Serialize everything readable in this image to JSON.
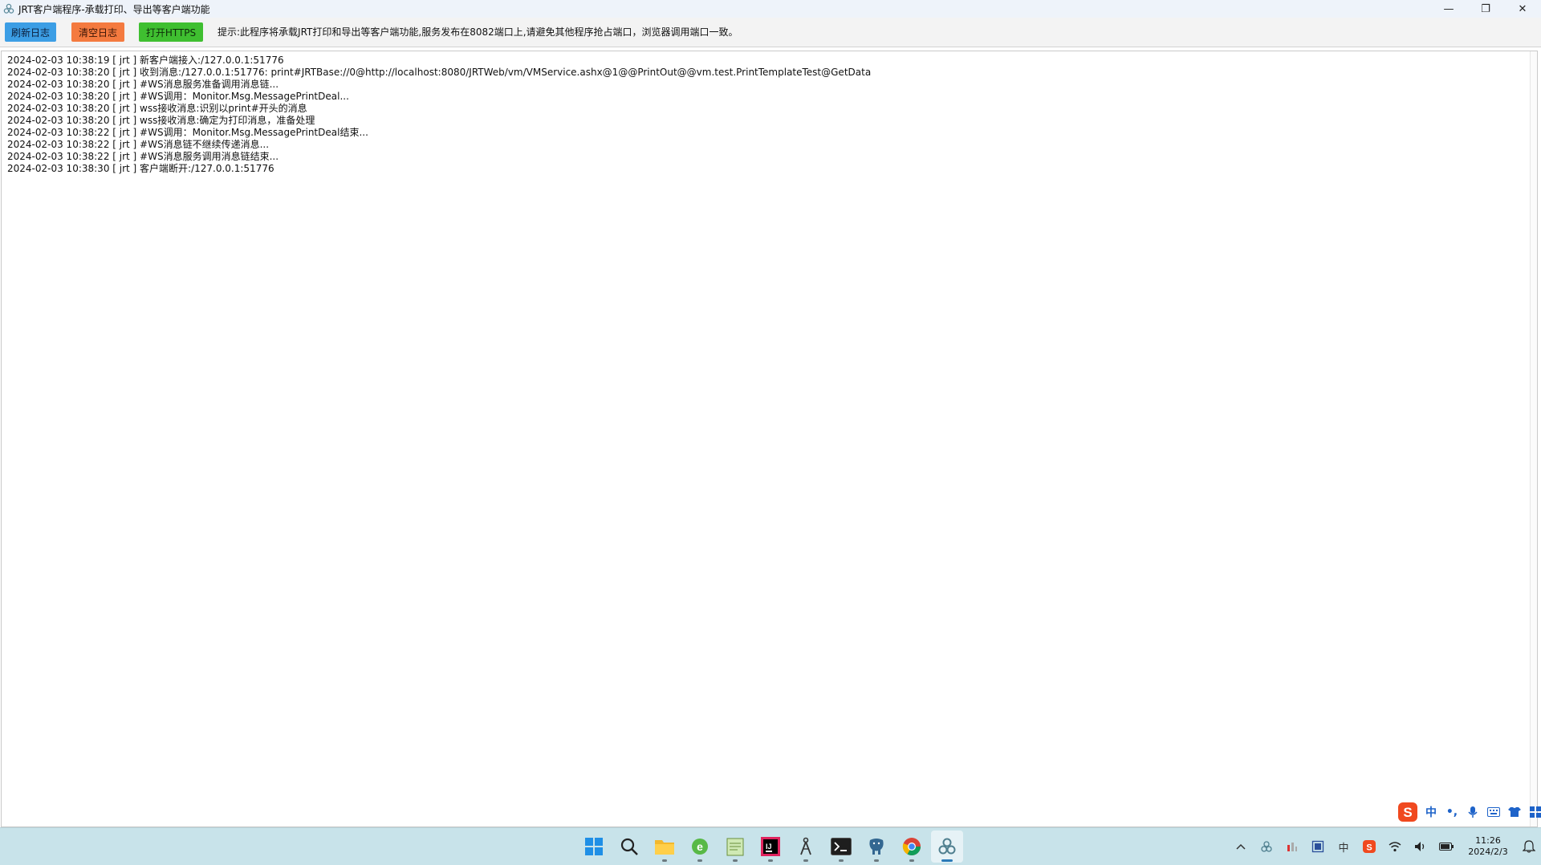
{
  "window": {
    "title": "JRT客户端程序-承载打印、导出等客户端功能",
    "controls": {
      "minimize": "—",
      "maximize": "❐",
      "close": "✕"
    }
  },
  "toolbar": {
    "refresh_label": "刷新日志",
    "clear_label": "清空日志",
    "https_label": "打开HTTPS",
    "tip": "提示:此程序将承载JRT打印和导出等客户端功能,服务发布在8082端口上,请避免其他程序抢占端口，浏览器调用端口一致。"
  },
  "log": {
    "lines": [
      "2024-02-03 10:38:19 [ jrt ]  新客户端接入:/127.0.0.1:51776",
      "2024-02-03 10:38:20 [ jrt ]  收到消息:/127.0.0.1:51776: print#JRTBase://0@http://localhost:8080/JRTWeb/vm/VMService.ashx@1@@PrintOut@@vm.test.PrintTemplateTest@GetData",
      "2024-02-03 10:38:20 [ jrt ]  #WS消息服务准备调用消息链...",
      "2024-02-03 10:38:20 [ jrt ]  #WS调用：Monitor.Msg.MessagePrintDeal...",
      "2024-02-03 10:38:20 [ jrt ]  wss接收消息:识别以print#开头的消息",
      "2024-02-03 10:38:20 [ jrt ]  wss接收消息:确定为打印消息，准备处理",
      "2024-02-03 10:38:22 [ jrt ]  #WS调用：Monitor.Msg.MessagePrintDeal结束...",
      "2024-02-03 10:38:22 [ jrt ]  #WS消息链不继续传递消息...",
      "2024-02-03 10:38:22 [ jrt ]  #WS消息服务调用消息链结束...",
      "2024-02-03 10:38:30 [ jrt ]  客户端断开:/127.0.0.1:51776"
    ]
  },
  "ime": {
    "logo": "S",
    "items": [
      {
        "icon": "chinese-mode-icon",
        "text": "中"
      },
      {
        "icon": "punctuation-icon",
        "text": "•,"
      },
      {
        "icon": "microphone-icon",
        "text": ""
      },
      {
        "icon": "keyboard-icon",
        "text": ""
      },
      {
        "icon": "skin-icon",
        "text": ""
      },
      {
        "icon": "toolbox-icon",
        "text": ""
      }
    ]
  },
  "taskbar": {
    "apps": [
      {
        "name": "start-icon",
        "active": false
      },
      {
        "name": "search-icon",
        "active": false
      },
      {
        "name": "file-explorer-icon",
        "active": false
      },
      {
        "name": "browser-e-icon",
        "active": false
      },
      {
        "name": "notepad-icon",
        "active": false
      },
      {
        "name": "intellij-icon",
        "active": false
      },
      {
        "name": "compass-icon",
        "active": false
      },
      {
        "name": "terminal-icon",
        "active": false
      },
      {
        "name": "postgres-icon",
        "active": false
      },
      {
        "name": "chrome-icon",
        "active": false
      },
      {
        "name": "jrt-client-icon",
        "active": true
      }
    ],
    "tray": {
      "time": "11:26",
      "date": "2024/2/3",
      "ime_indicator": "中"
    }
  },
  "colors": {
    "refresh_button": "#3c9ee5",
    "clear_button": "#f47a3f",
    "https_button": "#3fbf30",
    "taskbar": "#c8e3ea",
    "titlebar": "#eef3fa"
  }
}
